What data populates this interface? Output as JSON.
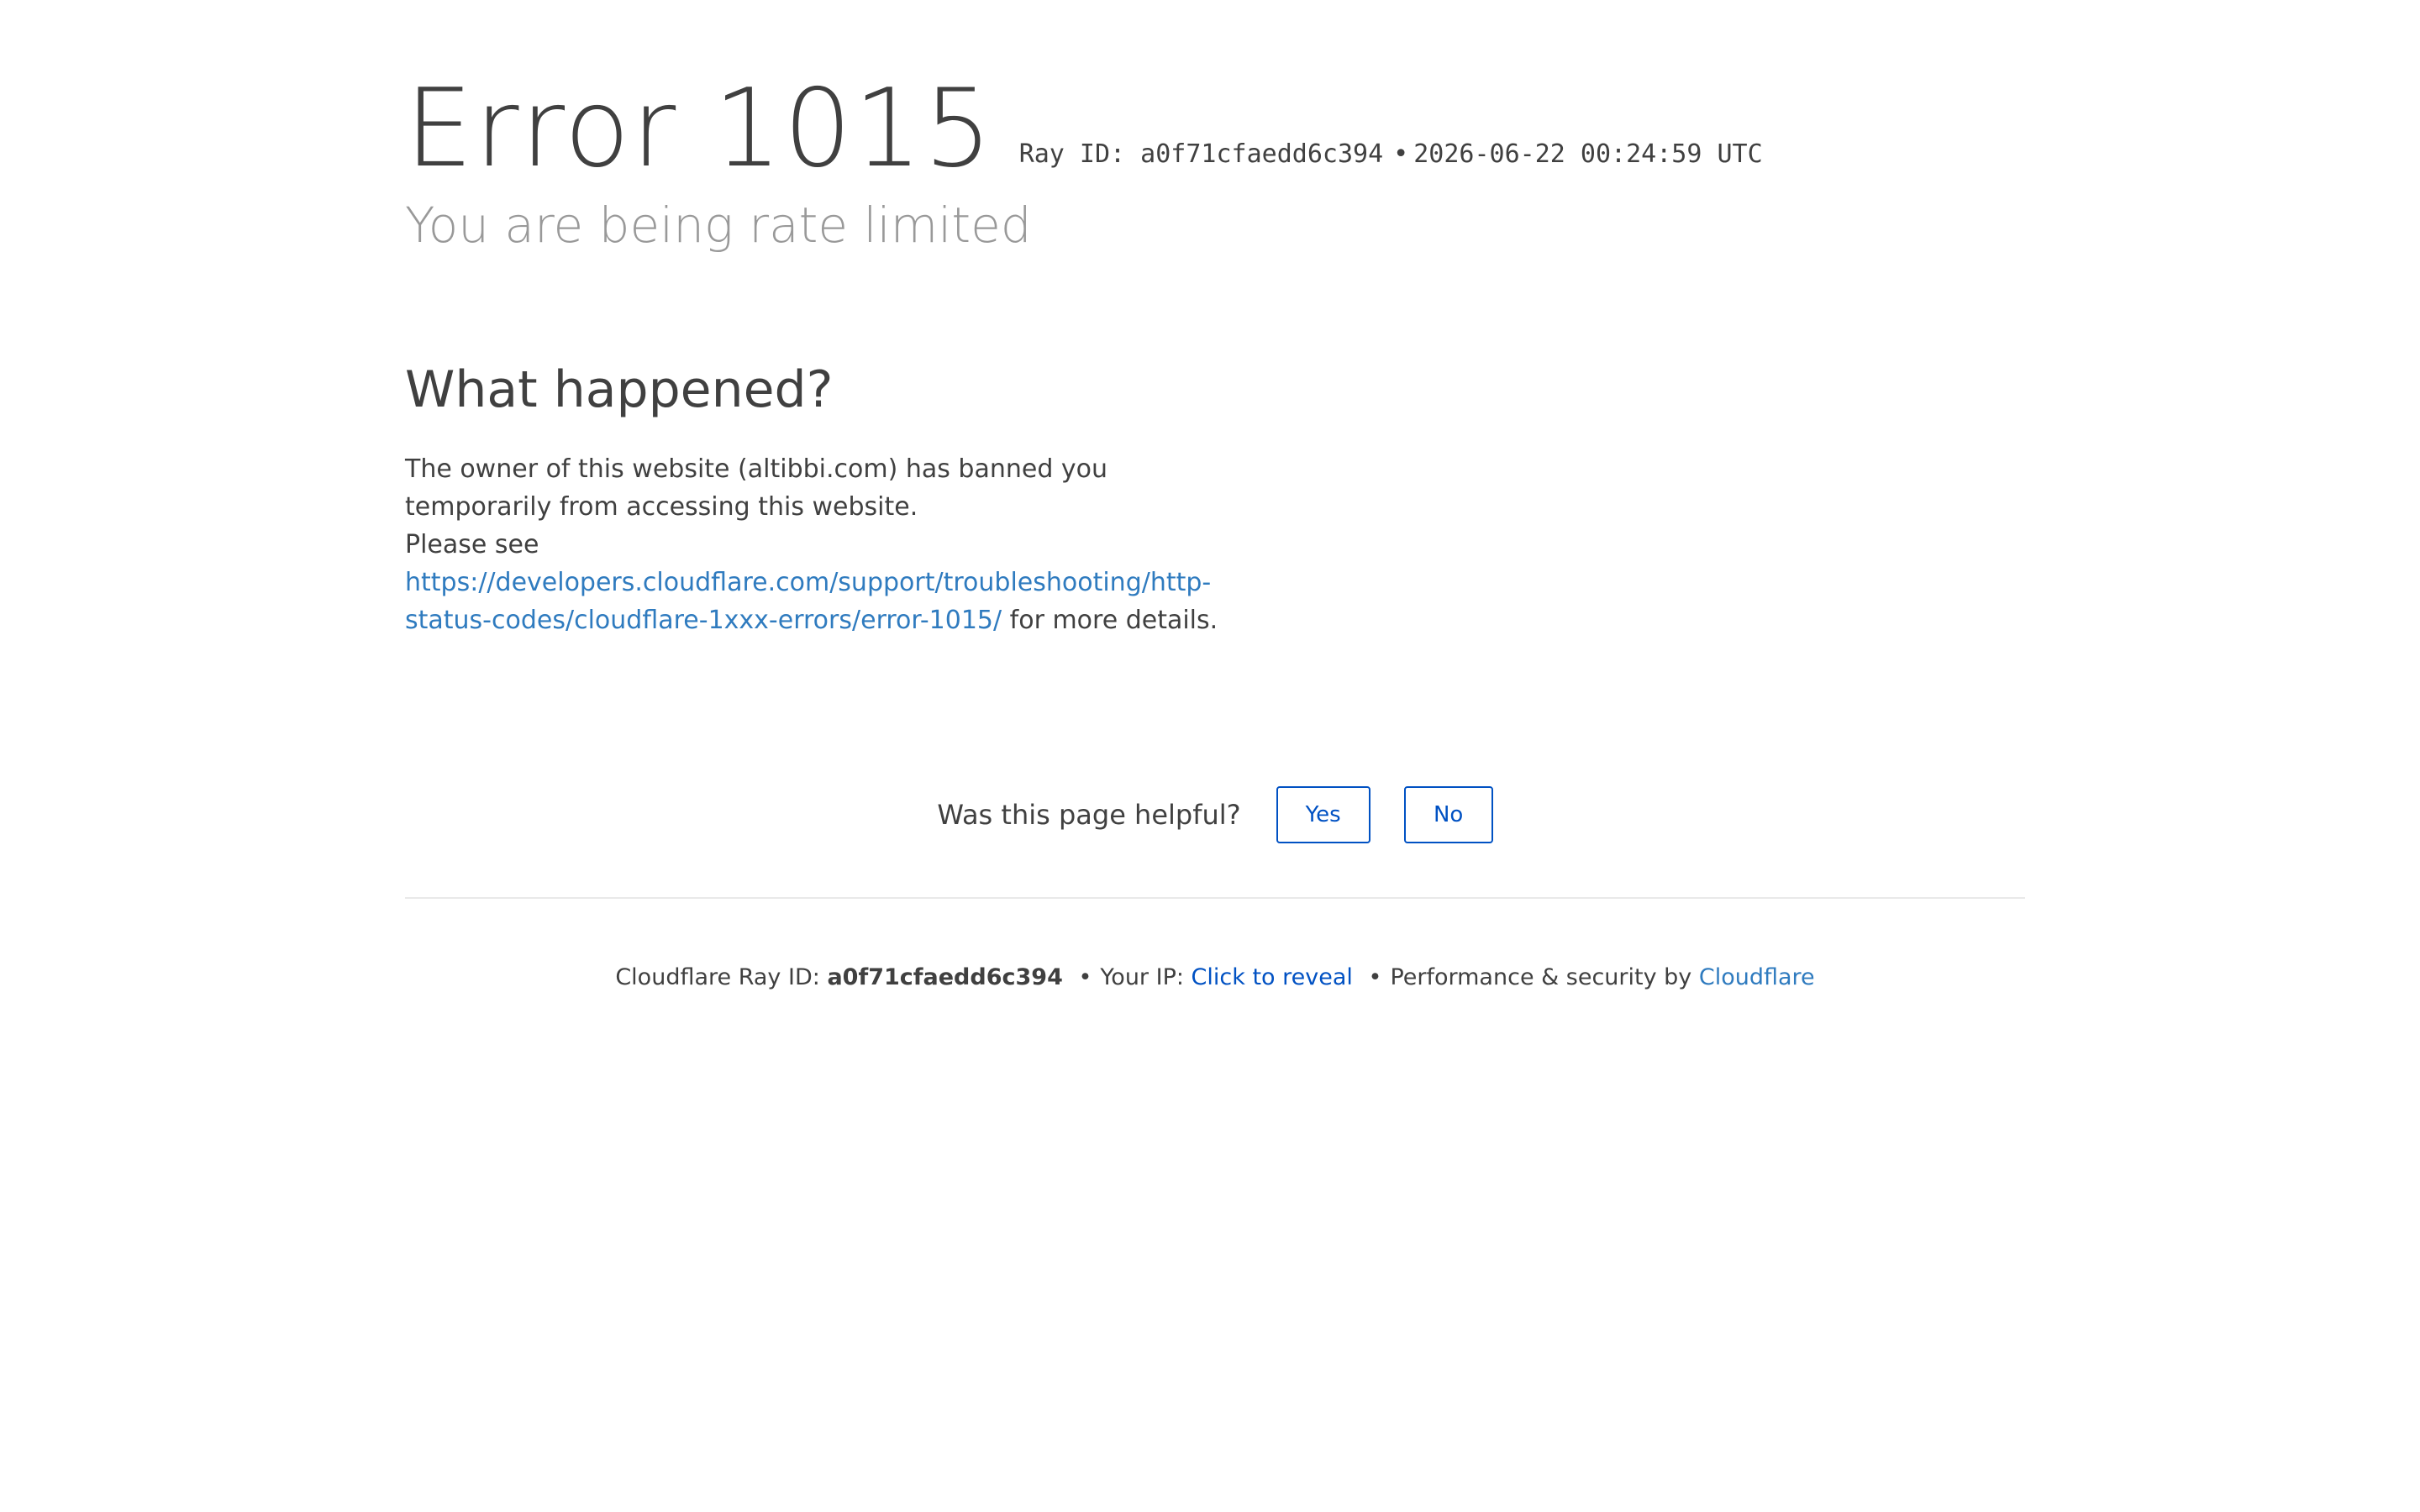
{
  "header": {
    "error_title": "Error 1015",
    "ray_label": "Ray ID: a0f71cfaedd6c394",
    "bullet": "•",
    "timestamp": "2026-06-22 00:24:59 UTC",
    "subtitle": "You are being rate limited"
  },
  "what_happened": {
    "heading": "What happened?",
    "line1": "The owner of this website (altibbi.com) has banned you temporarily from accessing this website.",
    "line2_prefix": "Please see",
    "link_text": "https://developers.cloudflare.com/support/troubleshooting/http-status-codes/cloudflare-1xxx-errors/error-1015/",
    "line2_suffix": "for more details."
  },
  "feedback": {
    "question": "Was this page helpful?",
    "yes_label": "Yes",
    "no_label": "No"
  },
  "footer": {
    "ray_prefix": "Cloudflare Ray ID:",
    "ray_id": "a0f71cfaedd6c394",
    "sep": "•",
    "ip_prefix": "Your IP:",
    "ip_reveal": "Click to reveal",
    "perf_prefix": "Performance & security by",
    "cloudflare_link": "Cloudflare"
  },
  "colors": {
    "text": "#404040",
    "muted": "#999999",
    "link": "#2f7bbf",
    "button_accent": "#0051c3",
    "divider": "#e9e9e9"
  }
}
